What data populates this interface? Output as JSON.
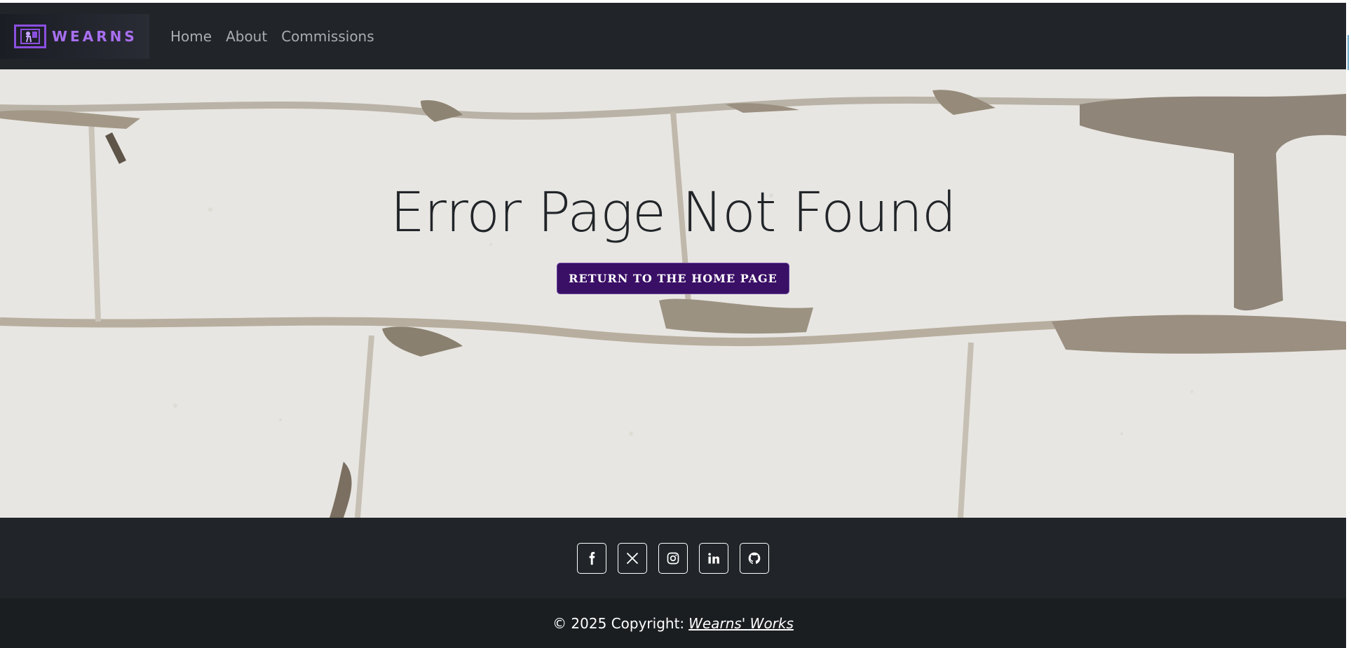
{
  "navbar": {
    "brand": "WEARNS",
    "links": [
      "Home",
      "About",
      "Commissions"
    ]
  },
  "hero": {
    "title": "Error Page Not Found",
    "button": "Return to the home page"
  },
  "footer": {
    "social": [
      "facebook-icon",
      "x-icon",
      "instagram-icon",
      "linkedin-icon",
      "github-icon"
    ],
    "copyright_prefix": "© 2025 Copyright:",
    "copyright_link": "Wearns' Works"
  },
  "colors": {
    "navbar_bg": "#212529",
    "brand_accent": "#a86ff0",
    "button_bg": "#3a0f66"
  }
}
